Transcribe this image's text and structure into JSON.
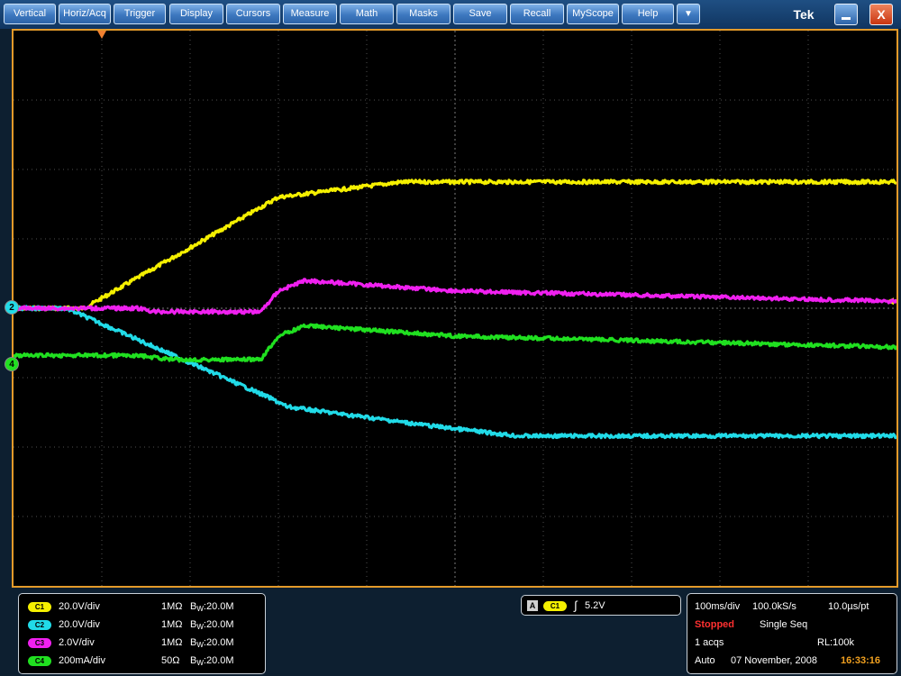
{
  "menu": {
    "items": [
      "Vertical",
      "Horiz/Acq",
      "Trigger",
      "Display",
      "Cursors",
      "Measure",
      "Math",
      "Masks",
      "Save",
      "Recall",
      "MyScope",
      "Help"
    ],
    "dropdown": "▼",
    "brand": "Tek",
    "close": "X"
  },
  "colors": {
    "ch1": "#f5f000",
    "ch2": "#21dbe8",
    "ch3": "#f020f0",
    "ch4": "#20e020",
    "graticule": "#e39a2a"
  },
  "markers": {
    "ch2": "2",
    "ch4": "4"
  },
  "channels": [
    {
      "badge": "C1",
      "scale": "20.0V/div",
      "impedance": "1MΩ",
      "bw_prefix": "B",
      "bw_sub": "W",
      "bw_value": ":20.0M"
    },
    {
      "badge": "C2",
      "scale": "20.0V/div",
      "impedance": "1MΩ",
      "bw_prefix": "B",
      "bw_sub": "W",
      "bw_value": ":20.0M"
    },
    {
      "badge": "C3",
      "scale": "2.0V/div",
      "impedance": "1MΩ",
      "bw_prefix": "B",
      "bw_sub": "W",
      "bw_value": ":20.0M"
    },
    {
      "badge": "C4",
      "scale": "200mA/div",
      "impedance": "50Ω",
      "bw_prefix": "B",
      "bw_sub": "W",
      "bw_value": ":20.0M"
    }
  ],
  "trigger": {
    "mode": "A",
    "source": "C1",
    "slope_symbol": "∫",
    "level": "5.2V"
  },
  "acquisition": {
    "timebase": "100ms/div",
    "sample_rate": "100.0kS/s",
    "resolution": "10.0µs/pt",
    "state": "Stopped",
    "mode": "Single Seq",
    "acqs": "1 acqs",
    "record_length": "RL:100k",
    "trigger_mode": "Auto",
    "date": "07 November, 2008",
    "time": "16:33:16"
  },
  "chart_data": {
    "type": "line",
    "x_divisions": 10,
    "y_divisions": 8,
    "xlim": [
      0,
      10
    ],
    "ylim": [
      -4,
      4
    ],
    "grid": true,
    "series": [
      {
        "channel": "C1",
        "x": [
          0,
          0.8,
          3.0,
          4.4,
          10
        ],
        "y": [
          0,
          0,
          1.6,
          1.82,
          1.82
        ]
      },
      {
        "channel": "C2",
        "x": [
          0,
          0.6,
          2.9,
          3.1,
          4.7,
          5.7,
          10
        ],
        "y": [
          0,
          0,
          -1.29,
          -1.42,
          -1.69,
          -1.84,
          -1.84
        ]
      },
      {
        "channel": "C3",
        "x": [
          0,
          1.4,
          1.6,
          2.8,
          3.0,
          3.3,
          5.0,
          10
        ],
        "y": [
          0,
          0,
          -0.05,
          -0.05,
          0.25,
          0.4,
          0.25,
          0.1
        ]
      },
      {
        "channel": "C4",
        "x": [
          0,
          1.4,
          1.8,
          2.8,
          3.0,
          3.3,
          5.0,
          10
        ],
        "y": [
          -0.68,
          -0.68,
          -0.74,
          -0.74,
          -0.4,
          -0.25,
          -0.4,
          -0.56
        ]
      }
    ]
  }
}
